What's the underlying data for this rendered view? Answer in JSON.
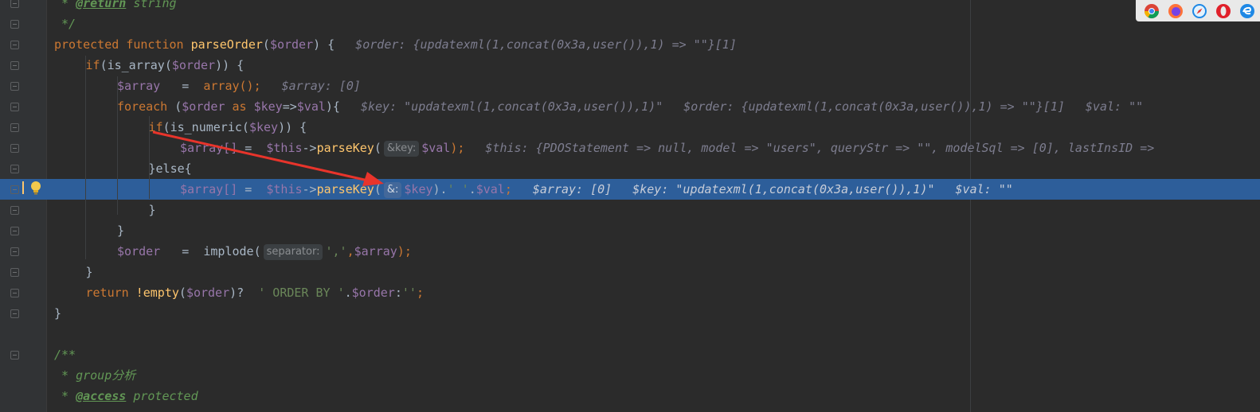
{
  "editor": {
    "lines": [
      {
        "kind": "comment",
        "indent": 0,
        "text": " * ",
        "tag": "@return",
        "rest": " string"
      },
      {
        "kind": "comment-plain",
        "indent": 0,
        "text": " */"
      },
      {
        "kind": "sig",
        "indent": 0,
        "kw1": "protected",
        "kw2": "function",
        "fn": "parseOrder",
        "param": "$order",
        "tail": ") {",
        "inline": "$order: {updatexml(1,concat(0x3a,user()),1) => \"\"}[1]"
      },
      {
        "kind": "if1",
        "indent": 1,
        "kw": "if",
        "fn": "is_array",
        "param": "$order",
        "tail": ")) {"
      },
      {
        "kind": "assign-arr",
        "indent": 2,
        "var": "$array",
        "eq": "   =  ",
        "fn": "array",
        "tail": "();",
        "inline": "$array: [0]"
      },
      {
        "kind": "foreach",
        "indent": 2,
        "kw": "foreach",
        "var1": "$order",
        "kw2": "as",
        "var2": "$key",
        "var3": "$val",
        "inline1": "$key: \"updatexml(1,concat(0x3a,user()),1)\"",
        "inline2": "$order: {updatexml(1,concat(0x3a,user()),1) => \"\"}[1]",
        "inline3": "$val: \"\""
      },
      {
        "kind": "if2",
        "indent": 3,
        "kw": "if",
        "fn": "is_numeric",
        "param": "$key",
        "tail": ")) {"
      },
      {
        "kind": "call1",
        "indent": 4,
        "var": "$array[]",
        "eq": " =  ",
        "this": "$this",
        "fn": "parseKey",
        "hint": "&key:",
        "param": "$val",
        "tail": ");",
        "inline": "$this: {PDOStatement => null, model => \"users\", queryStr => \"\", modelSql => [0], lastInsID =>"
      },
      {
        "kind": "else",
        "indent": 3,
        "text": "}else{"
      },
      {
        "kind": "call2",
        "indent": 4,
        "var": "$array[]",
        "eq": " =  ",
        "this": "$this",
        "fn": "parseKey",
        "hint": "&:",
        "param": "$key",
        "str": "' '",
        "var2": "$val",
        "inline1": "$array: [0]",
        "inline2": "$key: \"updatexml(1,concat(0x3a,user()),1)\"",
        "inline3": "$val: \"\""
      },
      {
        "kind": "close",
        "indent": 3,
        "text": "}"
      },
      {
        "kind": "close",
        "indent": 2,
        "text": "}"
      },
      {
        "kind": "implode",
        "indent": 2,
        "var": "$order",
        "eq": "   =  ",
        "fn": "implode",
        "hint": "separator:",
        "str": "','",
        "param": "$array",
        "tail": ");"
      },
      {
        "kind": "close",
        "indent": 1,
        "text": "}"
      },
      {
        "kind": "return",
        "indent": 1,
        "kw": "return",
        "fn": "!empty",
        "param": "$order",
        "mid": ")?  ",
        "str1": "' ORDER BY '",
        "var2": "$order",
        "str2": "''",
        "tail": ";"
      },
      {
        "kind": "close",
        "indent": 0,
        "text": "}"
      },
      {
        "kind": "blank"
      },
      {
        "kind": "comment-plain",
        "indent": 0,
        "text": "/**"
      },
      {
        "kind": "comment-plain",
        "indent": 0,
        "text": " * group分析"
      },
      {
        "kind": "comment",
        "indent": 0,
        "text": " * ",
        "tag": "@access",
        "rest": " protected"
      }
    ]
  },
  "browser_icons": [
    "chrome-icon",
    "firefox-icon",
    "safari-icon",
    "opera-icon",
    "edge-icon"
  ],
  "colors": {
    "keyword": "#cc7832",
    "function": "#ffc66d",
    "variable": "#9876aa",
    "string": "#6a8759",
    "highlight": "#2d5e9a",
    "arrow": "#e8342b"
  }
}
